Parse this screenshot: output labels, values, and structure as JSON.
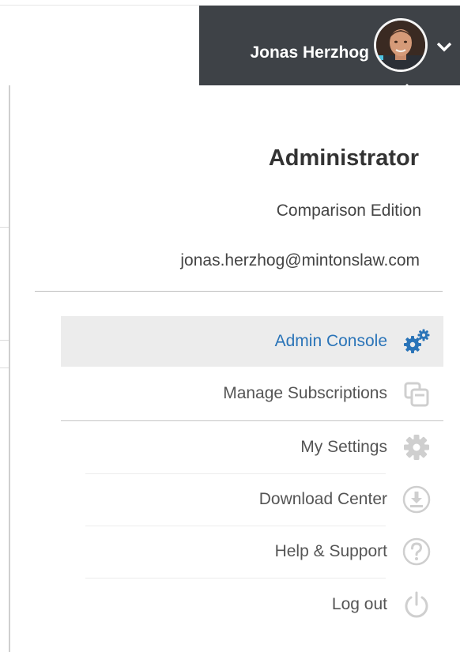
{
  "user": {
    "name": "Jonas Herzhog",
    "role": "Administrator",
    "edition": "Comparison Edition",
    "email": "jonas.herzhog@mintonslaw.com"
  },
  "menu": {
    "items": [
      {
        "label": "Admin Console",
        "icon": "gears-icon",
        "active": true
      },
      {
        "label": "Manage Subscriptions",
        "icon": "subscriptions-icon",
        "active": false
      },
      {
        "label": "My Settings",
        "icon": "gear-icon",
        "active": false
      },
      {
        "label": "Download Center",
        "icon": "download-icon",
        "active": false
      },
      {
        "label": "Help & Support",
        "icon": "help-icon",
        "active": false
      },
      {
        "label": "Log out",
        "icon": "power-icon",
        "active": false
      }
    ]
  },
  "colors": {
    "header_bg": "#3e4247",
    "accent": "#2a74b8",
    "active_bg": "#ececec",
    "icon_gray": "#cfcfcf"
  }
}
